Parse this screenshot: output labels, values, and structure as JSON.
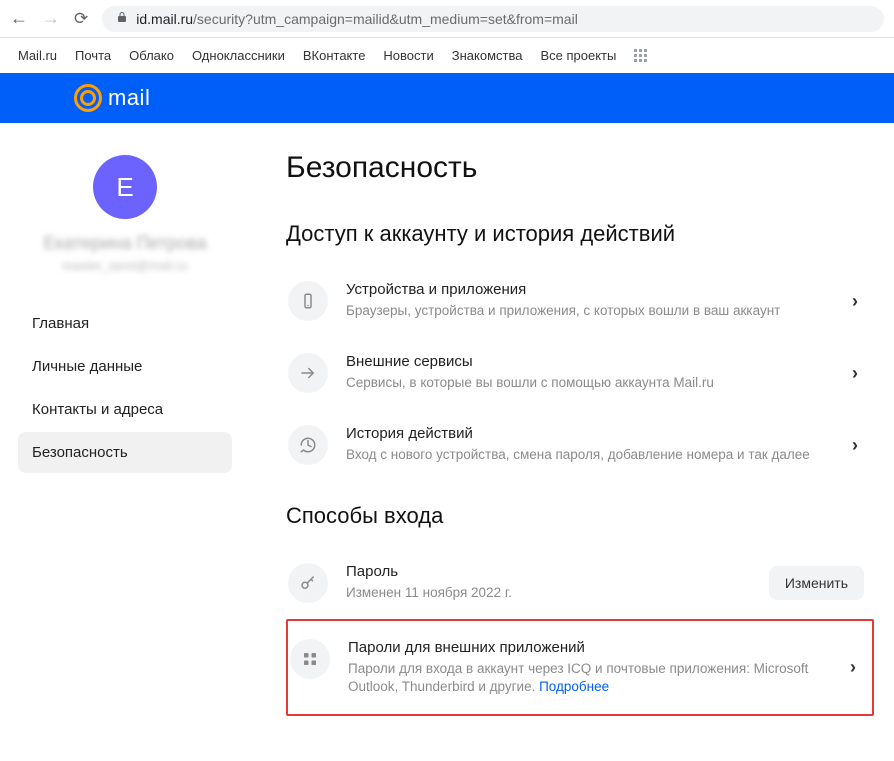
{
  "browser": {
    "url_host": "id.mail.ru",
    "url_path": "/security?utm_campaign=mailid&utm_medium=set&from=mail"
  },
  "topbar": {
    "links": [
      "Mail.ru",
      "Почта",
      "Облако",
      "Одноклассники",
      "ВКонтакте",
      "Новости",
      "Знакомства",
      "Все проекты"
    ]
  },
  "logo": {
    "text": "mail"
  },
  "sidebar": {
    "avatar_initial": "Е",
    "name_blur": "Екатерина Петрова",
    "email_blur": "master_tarot@mail.ru",
    "menu": [
      {
        "label": "Главная",
        "active": false
      },
      {
        "label": "Личные данные",
        "active": false
      },
      {
        "label": "Контакты и адреса",
        "active": false
      },
      {
        "label": "Безопасность",
        "active": true
      }
    ]
  },
  "page": {
    "title": "Безопасность",
    "section1": {
      "heading": "Доступ к аккаунту и история действий",
      "items": [
        {
          "icon": "device",
          "title": "Устройства и приложения",
          "sub": "Браузеры, устройства и приложения, с которых вошли в ваш аккаунт"
        },
        {
          "icon": "arrow",
          "title": "Внешние сервисы",
          "sub": "Сервисы, в которые вы вошли с помощью аккаунта Mail.ru"
        },
        {
          "icon": "history",
          "title": "История действий",
          "sub": "Вход с нового устройства, смена пароля, добавление номера и так далее"
        }
      ]
    },
    "section2": {
      "heading": "Способы входа",
      "password": {
        "icon": "key",
        "title": "Пароль",
        "sub": "Изменен 11 ноября 2022 г.",
        "button": "Изменить"
      },
      "app_passwords": {
        "icon": "grid",
        "title": "Пароли для внешних приложений",
        "sub_pre": "Пароли для входа в аккаунт через ICQ и почтовые приложения: Microsoft Outlook, Thunderbird и другие. ",
        "link": "Подробнее"
      }
    }
  }
}
